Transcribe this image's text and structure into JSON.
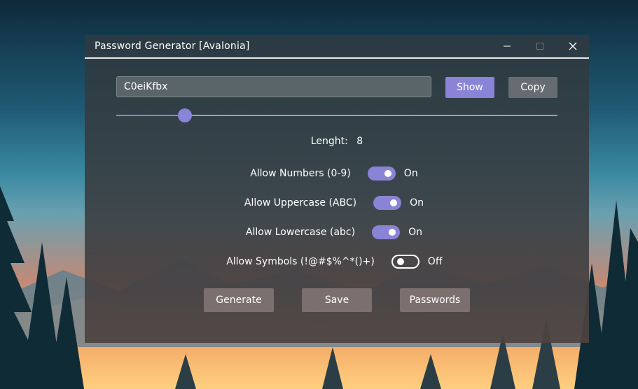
{
  "window": {
    "title": "Password Generator [Avalonia]"
  },
  "password": {
    "value": "C0eiKfbx"
  },
  "buttons": {
    "show": "Show",
    "copy": "Copy",
    "generate": "Generate",
    "save": "Save",
    "passwords": "Passwords"
  },
  "length": {
    "label": "Lenght:",
    "value": "8",
    "slider_fraction": 0.155
  },
  "options": [
    {
      "label": "Allow Numbers (0-9)",
      "state": "On",
      "enabled": true
    },
    {
      "label": "Allow Uppercase (ABC)",
      "state": "On",
      "enabled": true
    },
    {
      "label": "Allow Lowercase (abc)",
      "state": "On",
      "enabled": true
    },
    {
      "label": "Allow Symbols (!@#$%^*()+)",
      "state": "Off",
      "enabled": false
    }
  ],
  "colors": {
    "accent": "#8a84d6"
  },
  "icons": {
    "minimize": "minimize-icon",
    "maximize": "maximize-icon",
    "close": "close-icon"
  }
}
